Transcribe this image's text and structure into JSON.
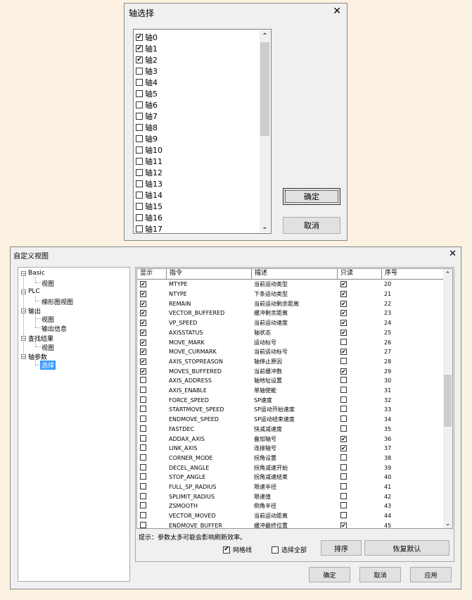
{
  "axis_dialog": {
    "title": "轴选择",
    "close": "✕",
    "items": [
      {
        "label": "轴0",
        "checked": true
      },
      {
        "label": "轴1",
        "checked": true
      },
      {
        "label": "轴2",
        "checked": true
      },
      {
        "label": "轴3",
        "checked": false
      },
      {
        "label": "轴4",
        "checked": false
      },
      {
        "label": "轴5",
        "checked": false
      },
      {
        "label": "轴6",
        "checked": false
      },
      {
        "label": "轴7",
        "checked": false
      },
      {
        "label": "轴8",
        "checked": false
      },
      {
        "label": "轴9",
        "checked": false
      },
      {
        "label": "轴10",
        "checked": false
      },
      {
        "label": "轴11",
        "checked": false
      },
      {
        "label": "轴12",
        "checked": false
      },
      {
        "label": "轴13",
        "checked": false
      },
      {
        "label": "轴14",
        "checked": false
      },
      {
        "label": "轴15",
        "checked": false
      },
      {
        "label": "轴16",
        "checked": false
      },
      {
        "label": "轴17",
        "checked": false
      }
    ],
    "ok_label": "确定",
    "cancel_label": "取消"
  },
  "view_dialog": {
    "title": "自定义视图",
    "close": "✕",
    "tree": {
      "basic": "Basic",
      "basic_view": "视图",
      "plc": "PLC",
      "plc_ladder": "梯形图视图",
      "output": "输出",
      "output_view": "视图",
      "output_info": "输出信息",
      "search": "查找结果",
      "search_view": "视图",
      "axis_params": "轴参数",
      "axis_select": "选择"
    },
    "columns": [
      "显示",
      "指令",
      "描述",
      "只读",
      "序号"
    ],
    "rows": [
      {
        "show": true,
        "cmd": "MTYPE",
        "desc": "当前运动类型",
        "ro": true,
        "no": "20"
      },
      {
        "show": true,
        "cmd": "NTYPE",
        "desc": "下条运动类型",
        "ro": true,
        "no": "21"
      },
      {
        "show": true,
        "cmd": "REMAIN",
        "desc": "当前运动剩余距离",
        "ro": true,
        "no": "22"
      },
      {
        "show": true,
        "cmd": "VECTOR_BUFFERED",
        "desc": "缓冲剩余距离",
        "ro": true,
        "no": "23"
      },
      {
        "show": true,
        "cmd": "VP_SPEED",
        "desc": "当前运动速度",
        "ro": true,
        "no": "24"
      },
      {
        "show": true,
        "cmd": "AXISSTATUS",
        "desc": "轴状态",
        "ro": true,
        "no": "25"
      },
      {
        "show": true,
        "cmd": "MOVE_MARK",
        "desc": "运动标号",
        "ro": false,
        "no": "26"
      },
      {
        "show": true,
        "cmd": "MOVE_CURMARK",
        "desc": "当前运动标号",
        "ro": true,
        "no": "27"
      },
      {
        "show": true,
        "cmd": "AXIS_STOPREASON",
        "desc": "轴停止原因",
        "ro": false,
        "no": "28"
      },
      {
        "show": true,
        "cmd": "MOVES_BUFFERED",
        "desc": "当前缓冲数",
        "ro": true,
        "no": "29"
      },
      {
        "show": false,
        "cmd": "AXIS_ADDRESS",
        "desc": "轴地址设置",
        "ro": false,
        "no": "30"
      },
      {
        "show": false,
        "cmd": "AXIS_ENABLE",
        "desc": "单轴使能",
        "ro": false,
        "no": "31"
      },
      {
        "show": false,
        "cmd": "FORCE_SPEED",
        "desc": "SP速度",
        "ro": false,
        "no": "32"
      },
      {
        "show": false,
        "cmd": "STARTMOVE_SPEED",
        "desc": "SP运动开始速度",
        "ro": false,
        "no": "33"
      },
      {
        "show": false,
        "cmd": "ENDMOVE_SPEED",
        "desc": "SP运动结束速度",
        "ro": false,
        "no": "34"
      },
      {
        "show": false,
        "cmd": "FASTDEC",
        "desc": "快减减速度",
        "ro": false,
        "no": "35"
      },
      {
        "show": false,
        "cmd": "ADDAX_AXIS",
        "desc": "叠加轴号",
        "ro": true,
        "no": "36"
      },
      {
        "show": false,
        "cmd": "LINK_AXIS",
        "desc": "连接轴号",
        "ro": true,
        "no": "37"
      },
      {
        "show": false,
        "cmd": "CORNER_MODE",
        "desc": "拐角设置",
        "ro": false,
        "no": "38"
      },
      {
        "show": false,
        "cmd": "DECEL_ANGLE",
        "desc": "拐角减速开始",
        "ro": false,
        "no": "39"
      },
      {
        "show": false,
        "cmd": "STOP_ANGLE",
        "desc": "拐角减速结束",
        "ro": false,
        "no": "40"
      },
      {
        "show": false,
        "cmd": "FULL_SP_RADIUS",
        "desc": "限速半径",
        "ro": false,
        "no": "41"
      },
      {
        "show": false,
        "cmd": "SPLIMIT_RADIUS",
        "desc": "限速值",
        "ro": false,
        "no": "42"
      },
      {
        "show": false,
        "cmd": "ZSMOOTH",
        "desc": "倒角半径",
        "ro": false,
        "no": "43"
      },
      {
        "show": false,
        "cmd": "VECTOR_MOVED",
        "desc": "当前运动距离",
        "ro": false,
        "no": "44"
      },
      {
        "show": false,
        "cmd": "ENDMOVE_BUFFER",
        "desc": "缓冲最终位置",
        "ro": true,
        "no": "45"
      }
    ],
    "hint": "提示：参数太多可能会影响刷新效率。",
    "grid_lines": {
      "label": "网格线",
      "checked": true
    },
    "select_all": {
      "label": "选择全部",
      "checked": false
    },
    "sort_label": "排序",
    "reset_label": "恢复默认",
    "ok_label": "确定",
    "cancel_label": "取消",
    "apply_label": "应用"
  }
}
